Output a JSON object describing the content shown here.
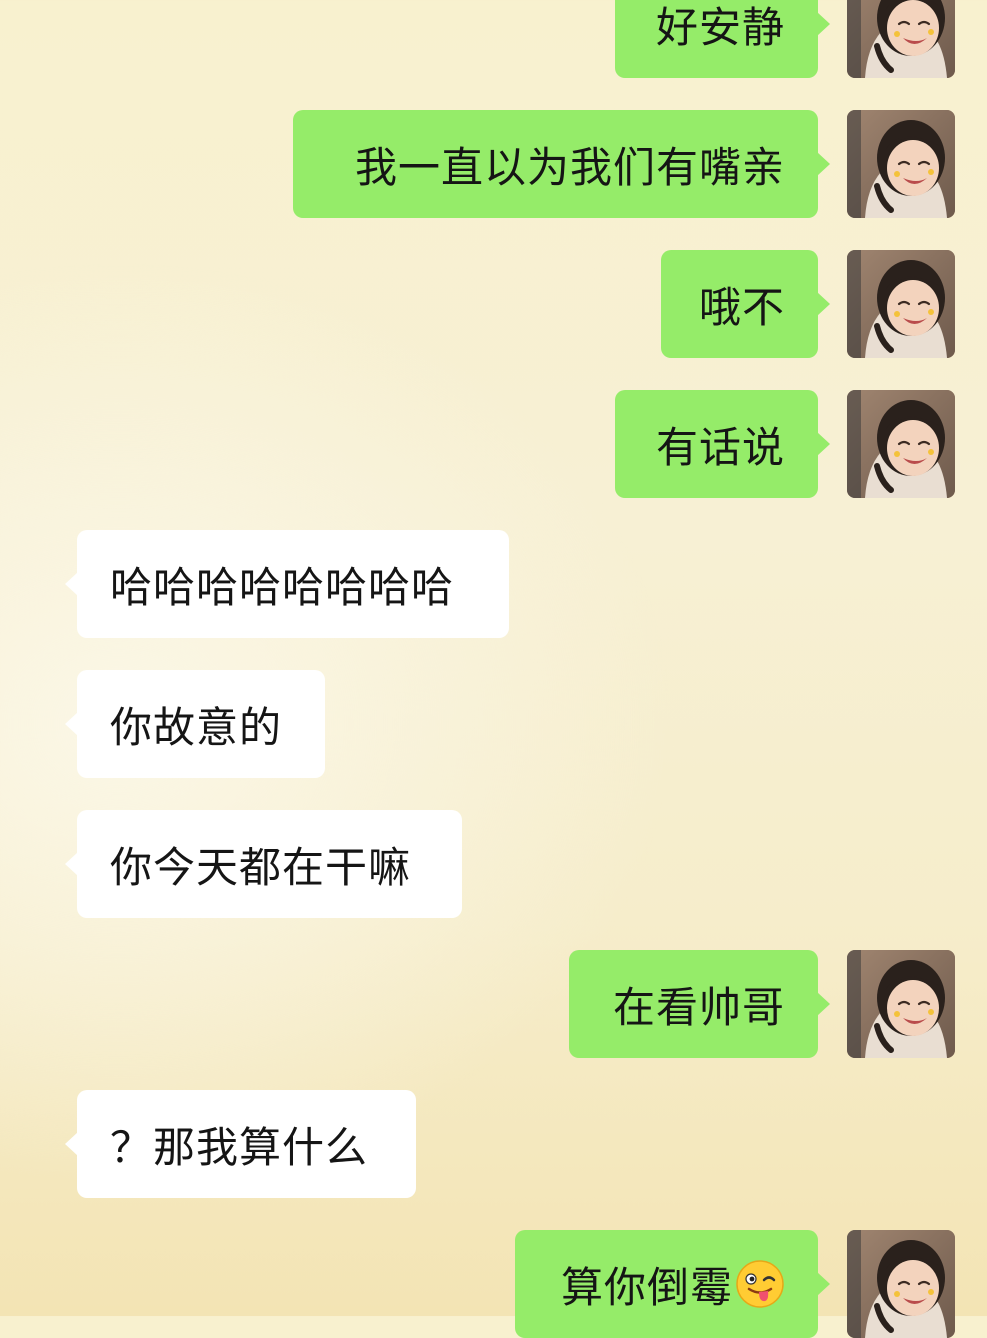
{
  "messages": [
    {
      "side": "out",
      "text": "好安静"
    },
    {
      "side": "out",
      "text": "我一直以为我们有嘴亲"
    },
    {
      "side": "out",
      "text": "哦不"
    },
    {
      "side": "out",
      "text": "有话说"
    },
    {
      "side": "in",
      "text": "哈哈哈哈哈哈哈哈"
    },
    {
      "side": "in",
      "text": "你故意的"
    },
    {
      "side": "in",
      "text": "你今天都在干嘛"
    },
    {
      "side": "out",
      "text": "在看帅哥"
    },
    {
      "side": "in",
      "text": "？那我算什么"
    },
    {
      "side": "out",
      "text": "算你倒霉",
      "emoji": "winking-face-tongue-icon"
    }
  ],
  "colors": {
    "outgoing_bubble": "#95ec69",
    "incoming_bubble": "#ffffff",
    "text": "#151515"
  },
  "avatar": {
    "icon": "smiling-child-avatar-icon"
  }
}
